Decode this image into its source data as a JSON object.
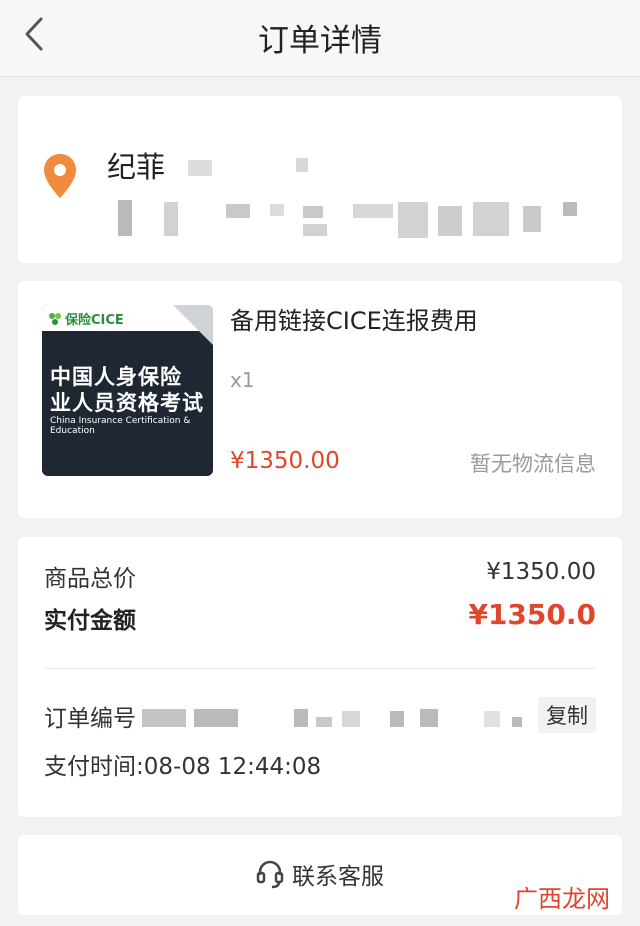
{
  "navbar": {
    "title": "订单详情"
  },
  "address": {
    "name": "纪菲"
  },
  "goods": {
    "thumbnail": {
      "logo_text": "保险CICE",
      "line1": "中国人身保险",
      "line2": "业人员资格考试",
      "english": "China Insurance Certification & Education"
    },
    "title": "备用链接CICE连报费用",
    "quantity": "x1",
    "price": "¥1350.00",
    "logistics": "暂无物流信息"
  },
  "payment": {
    "total_label": "商品总价",
    "total_value": "¥1350.00",
    "paid_label": "实付金额",
    "paid_value": "¥1350.0",
    "order_no_label": "订单编号",
    "copy_label": "复制",
    "pay_time": "支付时间:08-08 12:44:08"
  },
  "service": {
    "label": "联系客服"
  },
  "watermark": "广西龙网",
  "colors": {
    "accent": "#e0462b",
    "pin": "#f08a3c",
    "background": "#f2f2f2"
  }
}
